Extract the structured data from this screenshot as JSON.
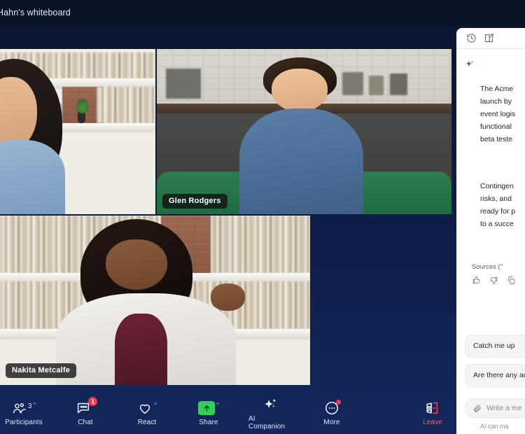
{
  "window": {
    "title": "Hahn's whiteboard"
  },
  "meeting": {
    "tiles": [
      {
        "id": "tile-1",
        "name": "",
        "active": true,
        "scene": "bookshelf-woman"
      },
      {
        "id": "tile-2",
        "name": "Glen Rodgers",
        "active": false,
        "scene": "kitchen-man"
      },
      {
        "id": "tile-3",
        "name": "Nakita Metcalfe",
        "active": false,
        "scene": "bookshelf-woman-2"
      }
    ]
  },
  "ai_panel": {
    "header": {
      "history_icon": "history-icon",
      "compose_icon": "compose-icon"
    },
    "message": {
      "icon": "ai-sparkle-icon",
      "paragraph_1": "The Acme\nlaunch by\nevent logis\nfunctional\nbeta teste",
      "paragraph_2": "Contingen\nrisks, and\nready for p\nto a succe",
      "sources_label": "Sources (\"",
      "feedback": {
        "thumbs_up_icon": "thumbs-up-icon",
        "thumbs_down_icon": "thumbs-down-icon",
        "copy_icon": "copy-icon"
      }
    },
    "suggestions": [
      {
        "label": "Catch me up"
      },
      {
        "label": "Are there any ac\nitems?"
      }
    ],
    "composer": {
      "attach_icon": "paperclip-icon",
      "placeholder": "Write a me"
    },
    "disclaimer": "AI can ma"
  },
  "toolbar": {
    "items": [
      {
        "key": "participants",
        "label": "Participants",
        "icon": "participants-icon",
        "count": "3",
        "caret": true,
        "badge": "",
        "dot": false
      },
      {
        "key": "chat",
        "label": "Chat",
        "icon": "chat-icon",
        "count": "",
        "caret": true,
        "badge": "1",
        "dot": false
      },
      {
        "key": "react",
        "label": "React",
        "icon": "heart-icon",
        "count": "",
        "caret": true,
        "badge": "",
        "dot": false
      },
      {
        "key": "share",
        "label": "Share",
        "icon": "share-screen-icon",
        "count": "",
        "caret": true,
        "badge": "",
        "dot": false
      },
      {
        "key": "ai_companion",
        "label": "AI Companion",
        "icon": "ai-sparkle-icon",
        "count": "",
        "caret": false,
        "badge": "",
        "dot": false
      },
      {
        "key": "more",
        "label": "More",
        "icon": "more-dots-icon",
        "count": "",
        "caret": false,
        "badge": "",
        "dot": true
      },
      {
        "key": "leave",
        "label": "Leave",
        "icon": "leave-door-icon",
        "count": "",
        "caret": false,
        "badge": "",
        "dot": false
      }
    ]
  },
  "colors": {
    "background_top": "#0a1430",
    "background_bottom": "#13275c",
    "titlebar": "#0a1226",
    "active_speaker": "#1db954",
    "badge_red": "#f4364c",
    "share_green": "#30d158",
    "leave_red": "#ff5a6e",
    "panel_white": "#ffffff"
  }
}
